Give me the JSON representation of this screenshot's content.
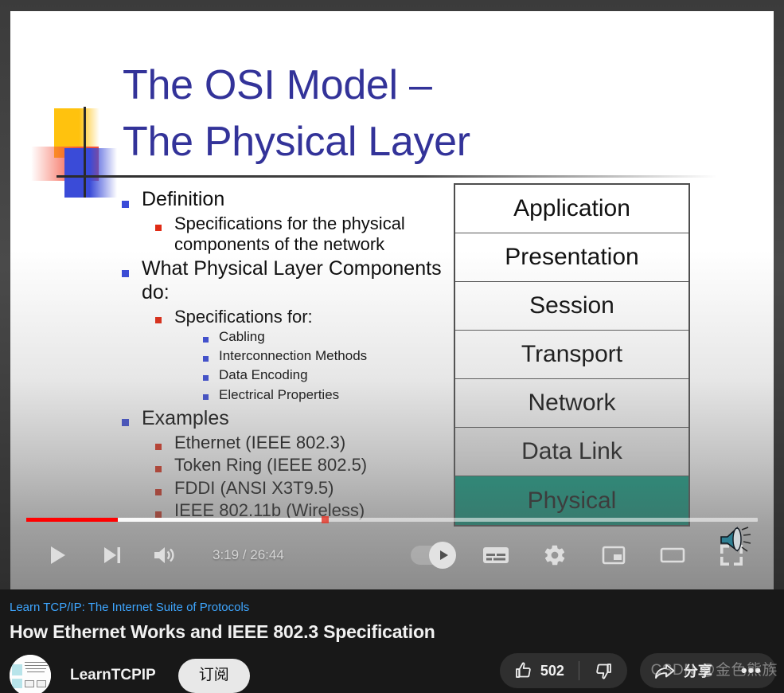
{
  "slide": {
    "title": "The OSI Model –\nThe Physical Layer",
    "title_color": "#333399",
    "bullets": [
      {
        "level": 1,
        "text": "Definition"
      },
      {
        "level": 2,
        "text": "Specifications for the physical components of the network"
      },
      {
        "level": 1,
        "text": "What Physical Layer Components do:"
      },
      {
        "level": 2,
        "text": "Specifications for:"
      },
      {
        "level": 3,
        "text": "Cabling"
      },
      {
        "level": 3,
        "text": "Interconnection Methods"
      },
      {
        "level": 3,
        "text": "Data Encoding"
      },
      {
        "level": 3,
        "text": "Electrical Properties"
      },
      {
        "level": 1,
        "text": "Examples"
      },
      {
        "level": 2,
        "text": "Ethernet (IEEE 802.3)"
      },
      {
        "level": 2,
        "text": "Token Ring (IEEE 802.5)"
      },
      {
        "level": 2,
        "text": "FDDI (ANSI X3T9.5)"
      },
      {
        "level": 2,
        "text": "IEEE 802.11b (Wireless)"
      }
    ],
    "osi_stack": {
      "highlight_color": "#00A183",
      "layers": [
        {
          "name": "Application",
          "highlighted": false
        },
        {
          "name": "Presentation",
          "highlighted": false
        },
        {
          "name": "Session",
          "highlighted": false
        },
        {
          "name": "Transport",
          "highlighted": false
        },
        {
          "name": "Network",
          "highlighted": false
        },
        {
          "name": "Data Link",
          "highlighted": false
        },
        {
          "name": "Physical",
          "highlighted": true
        }
      ]
    }
  },
  "player": {
    "time_label": "3:19 / 26:44",
    "current_time": "3:19",
    "duration": "26:44",
    "progress_percent": 12.5,
    "buffered_percent": 41,
    "progress_color": "#FF0000",
    "left_controls": [
      {
        "name": "play-button",
        "label": "Play"
      },
      {
        "name": "next-button",
        "label": "Next"
      },
      {
        "name": "volume-button",
        "label": "Mute"
      }
    ],
    "right_controls": [
      {
        "name": "autoplay-toggle",
        "label": "Autoplay",
        "state": "on"
      },
      {
        "name": "subtitles-button",
        "label": "Subtitles/CC"
      },
      {
        "name": "settings-button",
        "label": "Settings"
      },
      {
        "name": "miniplayer-button",
        "label": "Miniplayer"
      },
      {
        "name": "theater-button",
        "label": "Theater mode"
      },
      {
        "name": "fullscreen-button",
        "label": "Full screen"
      }
    ]
  },
  "info": {
    "playlist_link": "Learn TCP/IP: The Internet Suite of Protocols",
    "video_title": "How Ethernet Works and IEEE 802.3 Specification",
    "channel_name": "LearnTCPIP",
    "subscribe_label": "订阅",
    "like_count": "502",
    "share_label": "分享",
    "more_label": "•••",
    "link_color": "#3EA6FF"
  },
  "watermark": "CSDN @金色熊族"
}
